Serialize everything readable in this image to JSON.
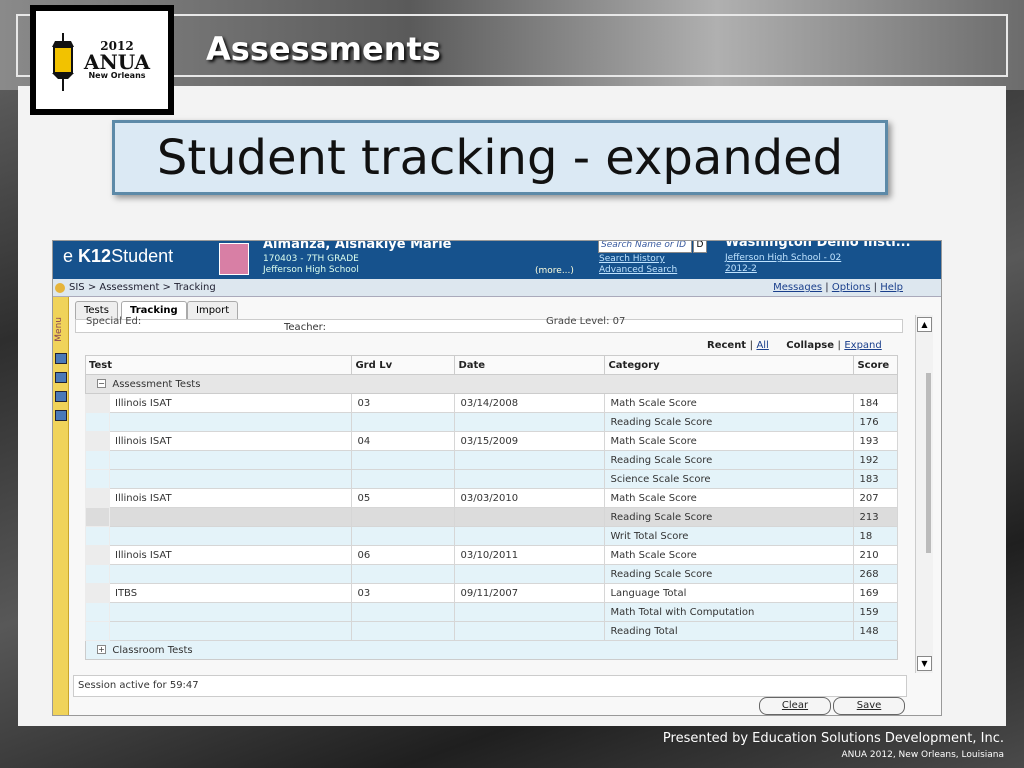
{
  "slide": {
    "header_title": "Assessments",
    "main_title": "Student tracking - expanded",
    "footer_line1": "Presented by Education Solutions Development, Inc.",
    "footer_line2": "ANUA 2012, New Orleans, Louisiana"
  },
  "logo": {
    "year": "2012",
    "name": "ANUA",
    "city": "New Orleans"
  },
  "app": {
    "brand_prefix": "e",
    "brand_bold": "K12",
    "brand_rest": "Student",
    "student_name": "Almanza, Aishakiye Marie",
    "student_line1": "170403 - 7TH GRADE",
    "student_line2": "Jefferson High School",
    "more_link": "(more...)",
    "search_placeholder": "Search Name or ID",
    "search_button": "D",
    "search_history": "Search History",
    "advanced_search": "Advanced Search",
    "institution_name": "Washington Demo Insti...",
    "institution_line1": "Jefferson High School - 02",
    "institution_line2": "2012-2",
    "breadcrumb": "SIS > Assessment > Tracking",
    "messages": "Messages",
    "options": "Options",
    "help": "Help",
    "menu_label": "Menu",
    "tabs": [
      "Tests",
      "Tracking",
      "Import"
    ],
    "filter_special_ed": "Special Ed:",
    "filter_teacher": "Teacher:",
    "filter_grade": "Grade Level: 07",
    "recent_label": "Recent",
    "all_label": "All",
    "collapse_label": "Collapse",
    "expand_label": "Expand",
    "columns": [
      "Test",
      "Grd Lv",
      "Date",
      "Category",
      "Score"
    ],
    "group1": "Assessment Tests",
    "group2": "Classroom Tests",
    "rows": [
      [
        "Illinois ISAT",
        "03",
        "03/14/2008",
        "Math Scale Score",
        "184"
      ],
      [
        "",
        "",
        "",
        "Reading Scale Score",
        "176"
      ],
      [
        "Illinois ISAT",
        "04",
        "03/15/2009",
        "Math Scale Score",
        "193"
      ],
      [
        "",
        "",
        "",
        "Reading Scale Score",
        "192"
      ],
      [
        "",
        "",
        "",
        "Science Scale Score",
        "183"
      ],
      [
        "Illinois ISAT",
        "05",
        "03/03/2010",
        "Math Scale Score",
        "207"
      ],
      [
        "",
        "",
        "",
        "Reading Scale Score",
        "213"
      ],
      [
        "",
        "",
        "",
        "Writ Total Score",
        "18"
      ],
      [
        "Illinois ISAT",
        "06",
        "03/10/2011",
        "Math Scale Score",
        "210"
      ],
      [
        "",
        "",
        "",
        "Reading Scale Score",
        "268"
      ],
      [
        "ITBS",
        "03",
        "09/11/2007",
        "Language Total",
        "169"
      ],
      [
        "",
        "",
        "",
        "Math Total with Computation",
        "159"
      ],
      [
        "",
        "",
        "",
        "Reading Total",
        "148"
      ]
    ],
    "session": "Session active for 59:47",
    "clear_button": "Clear",
    "save_button": "Save"
  }
}
